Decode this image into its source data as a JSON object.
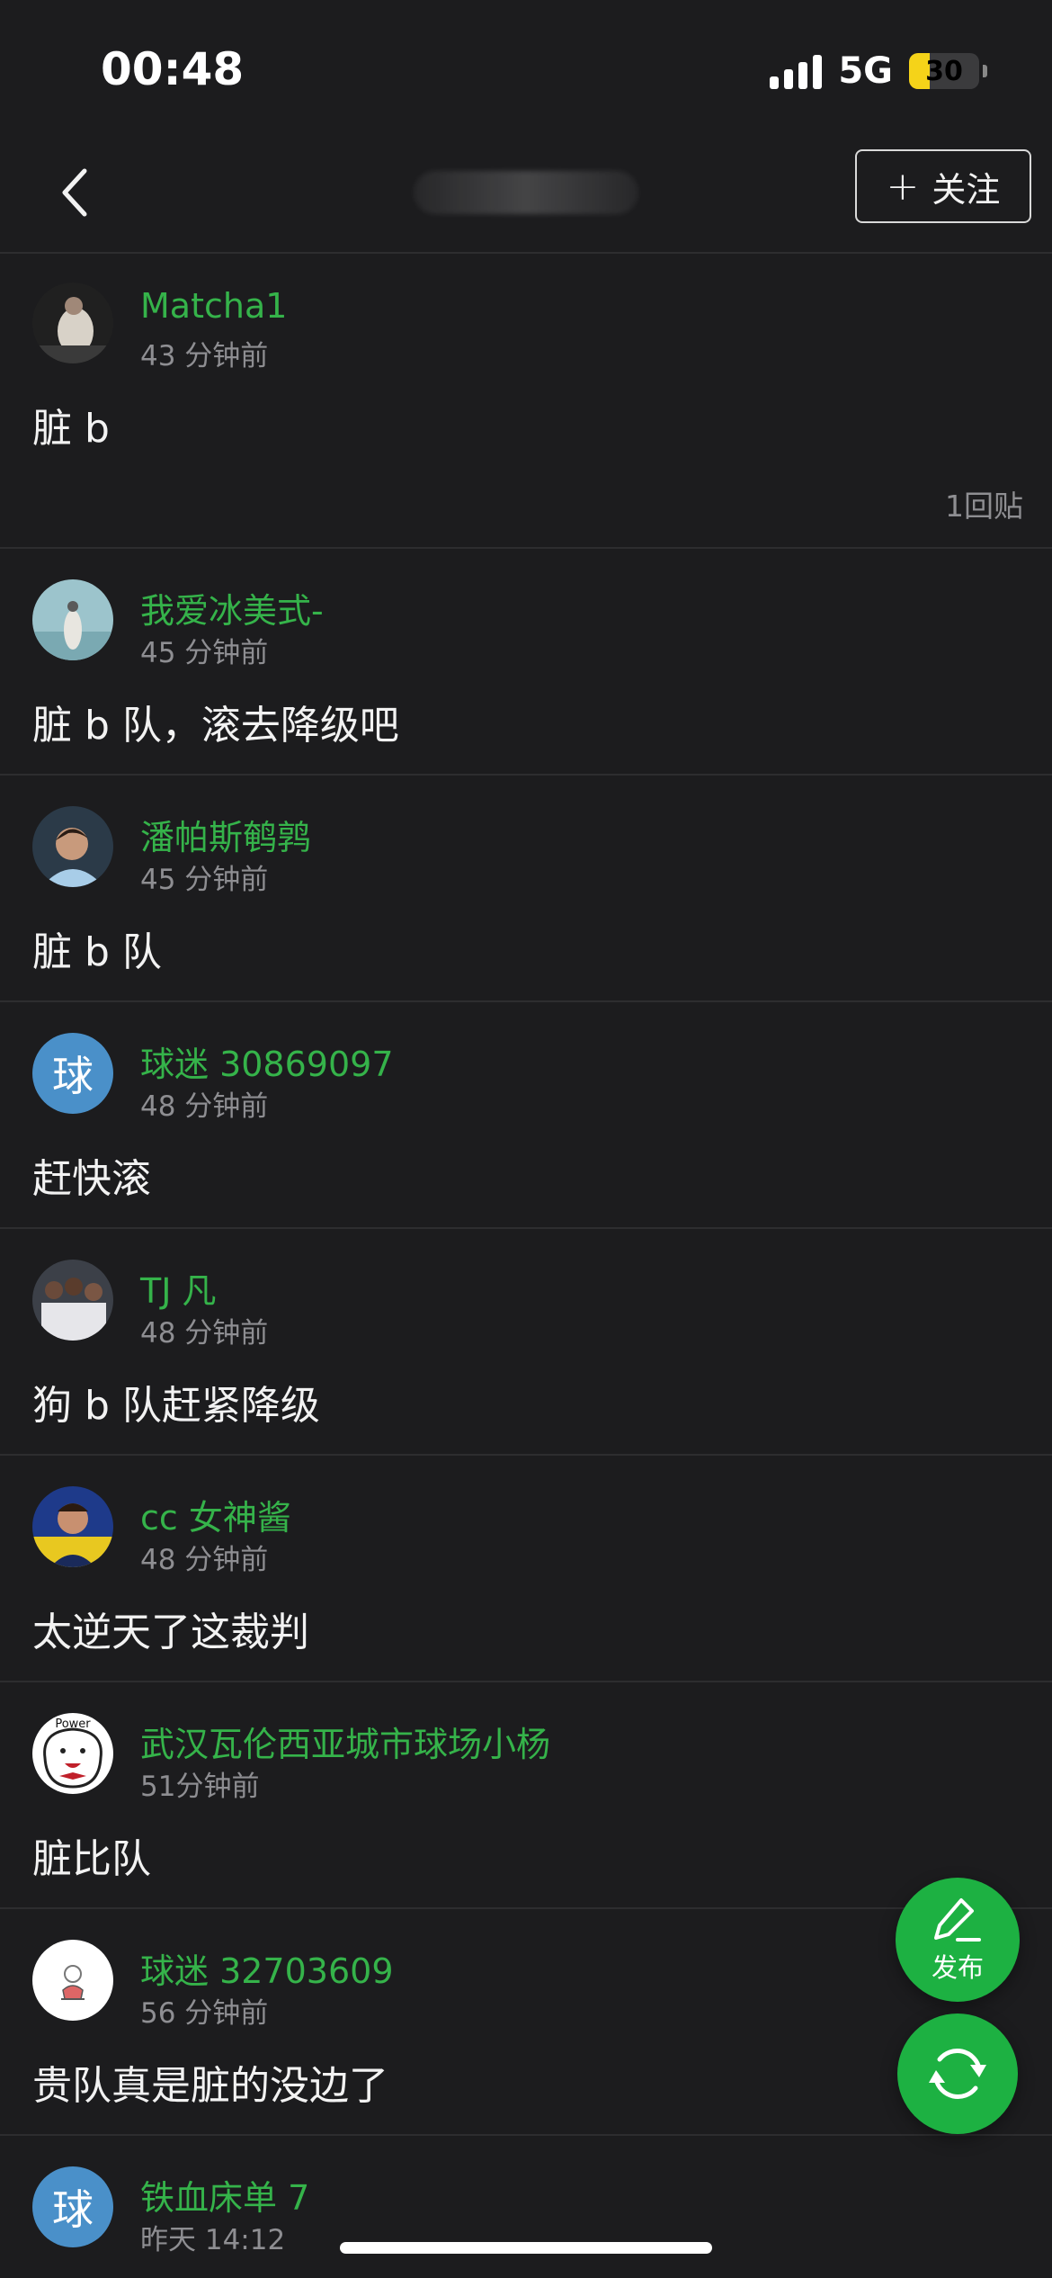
{
  "status_bar": {
    "time": "00:48",
    "network": "5G",
    "battery": "30",
    "battery_level_percent": 30
  },
  "nav": {
    "follow_label": "关注"
  },
  "posts": [
    {
      "username": "Matcha1",
      "time": "43 分钟前",
      "content": "脏 b",
      "replies": "1回贴"
    },
    {
      "username": "我爱冰美式-",
      "time": "45 分钟前",
      "content": "脏 b 队，滚去降级吧"
    },
    {
      "username": "潘帕斯鹌鹑",
      "time": "45 分钟前",
      "content": "脏 b 队"
    },
    {
      "username": "球迷 30869097",
      "time": "48 分钟前",
      "content": "赶快滚",
      "avatar_char": "球"
    },
    {
      "username": "TJ 凡",
      "time": "48 分钟前",
      "content": "狗 b 队赶紧降级"
    },
    {
      "username": "cc 女神酱",
      "time": "48 分钟前",
      "content": "太逆天了这裁判"
    },
    {
      "username": "武汉瓦伦西亚城市球场小杨",
      "time": "51分钟前",
      "content": "脏比队",
      "avatar_text": "Power"
    },
    {
      "username": "球迷 32703609",
      "time": "56 分钟前",
      "content": "贵队真是脏的没边了"
    },
    {
      "username": "铁血床单 7",
      "time": "昨天 14:12",
      "content": "",
      "avatar_char": "球"
    }
  ],
  "fab": {
    "publish_label": "发布"
  },
  "colors": {
    "background": "#1c1c1e",
    "username": "#35b34a",
    "accent": "#1db142",
    "meta": "#8e8e92"
  }
}
